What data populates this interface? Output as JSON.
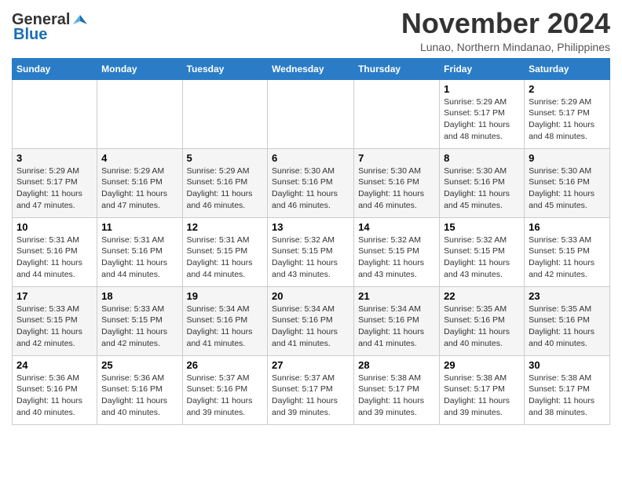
{
  "header": {
    "logo_general": "General",
    "logo_blue": "Blue",
    "month": "November 2024",
    "location": "Lunao, Northern Mindanao, Philippines"
  },
  "weekdays": [
    "Sunday",
    "Monday",
    "Tuesday",
    "Wednesday",
    "Thursday",
    "Friday",
    "Saturday"
  ],
  "weeks": [
    {
      "days": [
        {
          "num": "",
          "info": ""
        },
        {
          "num": "",
          "info": ""
        },
        {
          "num": "",
          "info": ""
        },
        {
          "num": "",
          "info": ""
        },
        {
          "num": "",
          "info": ""
        },
        {
          "num": "1",
          "info": "Sunrise: 5:29 AM\nSunset: 5:17 PM\nDaylight: 11 hours\nand 48 minutes."
        },
        {
          "num": "2",
          "info": "Sunrise: 5:29 AM\nSunset: 5:17 PM\nDaylight: 11 hours\nand 48 minutes."
        }
      ]
    },
    {
      "days": [
        {
          "num": "3",
          "info": "Sunrise: 5:29 AM\nSunset: 5:17 PM\nDaylight: 11 hours\nand 47 minutes."
        },
        {
          "num": "4",
          "info": "Sunrise: 5:29 AM\nSunset: 5:16 PM\nDaylight: 11 hours\nand 47 minutes."
        },
        {
          "num": "5",
          "info": "Sunrise: 5:29 AM\nSunset: 5:16 PM\nDaylight: 11 hours\nand 46 minutes."
        },
        {
          "num": "6",
          "info": "Sunrise: 5:30 AM\nSunset: 5:16 PM\nDaylight: 11 hours\nand 46 minutes."
        },
        {
          "num": "7",
          "info": "Sunrise: 5:30 AM\nSunset: 5:16 PM\nDaylight: 11 hours\nand 46 minutes."
        },
        {
          "num": "8",
          "info": "Sunrise: 5:30 AM\nSunset: 5:16 PM\nDaylight: 11 hours\nand 45 minutes."
        },
        {
          "num": "9",
          "info": "Sunrise: 5:30 AM\nSunset: 5:16 PM\nDaylight: 11 hours\nand 45 minutes."
        }
      ]
    },
    {
      "days": [
        {
          "num": "10",
          "info": "Sunrise: 5:31 AM\nSunset: 5:16 PM\nDaylight: 11 hours\nand 44 minutes."
        },
        {
          "num": "11",
          "info": "Sunrise: 5:31 AM\nSunset: 5:16 PM\nDaylight: 11 hours\nand 44 minutes."
        },
        {
          "num": "12",
          "info": "Sunrise: 5:31 AM\nSunset: 5:15 PM\nDaylight: 11 hours\nand 44 minutes."
        },
        {
          "num": "13",
          "info": "Sunrise: 5:32 AM\nSunset: 5:15 PM\nDaylight: 11 hours\nand 43 minutes."
        },
        {
          "num": "14",
          "info": "Sunrise: 5:32 AM\nSunset: 5:15 PM\nDaylight: 11 hours\nand 43 minutes."
        },
        {
          "num": "15",
          "info": "Sunrise: 5:32 AM\nSunset: 5:15 PM\nDaylight: 11 hours\nand 43 minutes."
        },
        {
          "num": "16",
          "info": "Sunrise: 5:33 AM\nSunset: 5:15 PM\nDaylight: 11 hours\nand 42 minutes."
        }
      ]
    },
    {
      "days": [
        {
          "num": "17",
          "info": "Sunrise: 5:33 AM\nSunset: 5:15 PM\nDaylight: 11 hours\nand 42 minutes."
        },
        {
          "num": "18",
          "info": "Sunrise: 5:33 AM\nSunset: 5:15 PM\nDaylight: 11 hours\nand 42 minutes."
        },
        {
          "num": "19",
          "info": "Sunrise: 5:34 AM\nSunset: 5:16 PM\nDaylight: 11 hours\nand 41 minutes."
        },
        {
          "num": "20",
          "info": "Sunrise: 5:34 AM\nSunset: 5:16 PM\nDaylight: 11 hours\nand 41 minutes."
        },
        {
          "num": "21",
          "info": "Sunrise: 5:34 AM\nSunset: 5:16 PM\nDaylight: 11 hours\nand 41 minutes."
        },
        {
          "num": "22",
          "info": "Sunrise: 5:35 AM\nSunset: 5:16 PM\nDaylight: 11 hours\nand 40 minutes."
        },
        {
          "num": "23",
          "info": "Sunrise: 5:35 AM\nSunset: 5:16 PM\nDaylight: 11 hours\nand 40 minutes."
        }
      ]
    },
    {
      "days": [
        {
          "num": "24",
          "info": "Sunrise: 5:36 AM\nSunset: 5:16 PM\nDaylight: 11 hours\nand 40 minutes."
        },
        {
          "num": "25",
          "info": "Sunrise: 5:36 AM\nSunset: 5:16 PM\nDaylight: 11 hours\nand 40 minutes."
        },
        {
          "num": "26",
          "info": "Sunrise: 5:37 AM\nSunset: 5:16 PM\nDaylight: 11 hours\nand 39 minutes."
        },
        {
          "num": "27",
          "info": "Sunrise: 5:37 AM\nSunset: 5:17 PM\nDaylight: 11 hours\nand 39 minutes."
        },
        {
          "num": "28",
          "info": "Sunrise: 5:38 AM\nSunset: 5:17 PM\nDaylight: 11 hours\nand 39 minutes."
        },
        {
          "num": "29",
          "info": "Sunrise: 5:38 AM\nSunset: 5:17 PM\nDaylight: 11 hours\nand 39 minutes."
        },
        {
          "num": "30",
          "info": "Sunrise: 5:38 AM\nSunset: 5:17 PM\nDaylight: 11 hours\nand 38 minutes."
        }
      ]
    }
  ]
}
